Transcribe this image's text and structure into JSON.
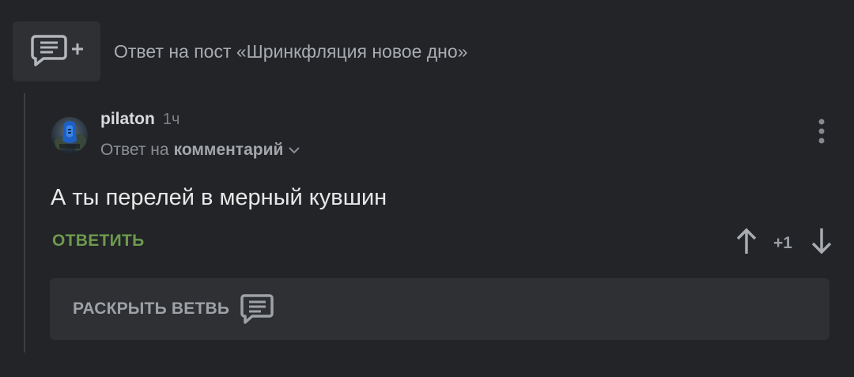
{
  "post": {
    "title": "Ответ на пост «Шринкфляция новое дно»",
    "add_comment_icon": "comment-add-icon"
  },
  "comment": {
    "author": "pilaton",
    "time": "1ч",
    "reply_prefix": "Ответ на",
    "reply_target": "комментарий",
    "text": "А ты перелей в мерный кувшин",
    "reply_label": "ОТВЕТИТЬ",
    "score": "+1"
  },
  "branch": {
    "expand_label": "РАСКРЫТЬ ВЕТВЬ",
    "icon": "comment-icon"
  },
  "colors": {
    "background": "#222427",
    "panel": "#2e3034",
    "accent_green": "#6e9a4e"
  }
}
